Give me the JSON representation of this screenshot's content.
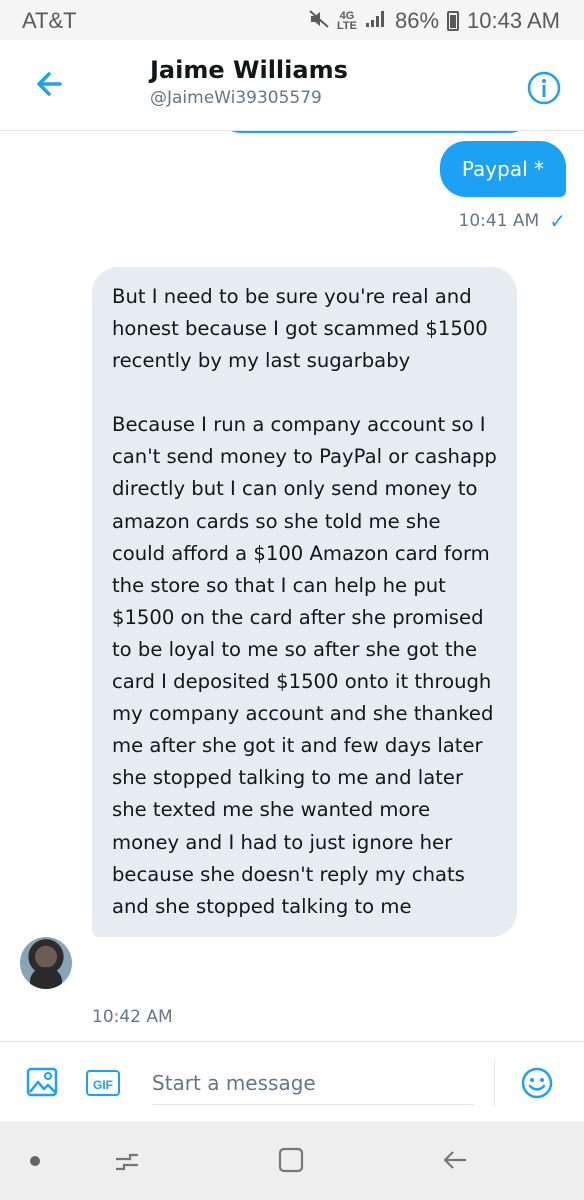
{
  "status_bar": {
    "carrier": "AT&T",
    "network": "4G LTE",
    "battery": "86%",
    "time": "10:43 AM"
  },
  "header": {
    "name": "Jaime Williams",
    "handle": "@JaimeWi39305579"
  },
  "messages": {
    "sent": {
      "text": "Paypal *",
      "time": "10:41 AM"
    },
    "received": {
      "paragraph_1": "But I need to be sure you're real and honest because I got scammed $1500 recently by my last sugarbaby",
      "paragraph_2": "Because I run a company account so I can't send money to PayPal or cashapp directly but I can only send money to amazon cards  so she told me she could afford a $100 Amazon card form the store so that I can help he put $1500 on the card after she promised to be loyal to me so after she got the card I deposited $1500 onto it through my company account and she thanked me after she got it and few days later she stopped talking to me and later she texted me she wanted more money and I had to just ignore her because she doesn't reply my chats and she stopped talking to me",
      "time": "10:42 AM"
    }
  },
  "compose": {
    "gif_label": "GIF",
    "placeholder": "Start a message"
  },
  "colors": {
    "accent": "#1da1f2",
    "bubble_received": "#e6ecf0",
    "secondary_text": "#657786"
  },
  "icons": {
    "back": "arrow-left-icon",
    "info": "info-icon",
    "image": "image-icon",
    "emoji": "emoji-icon",
    "read": "check-icon"
  }
}
